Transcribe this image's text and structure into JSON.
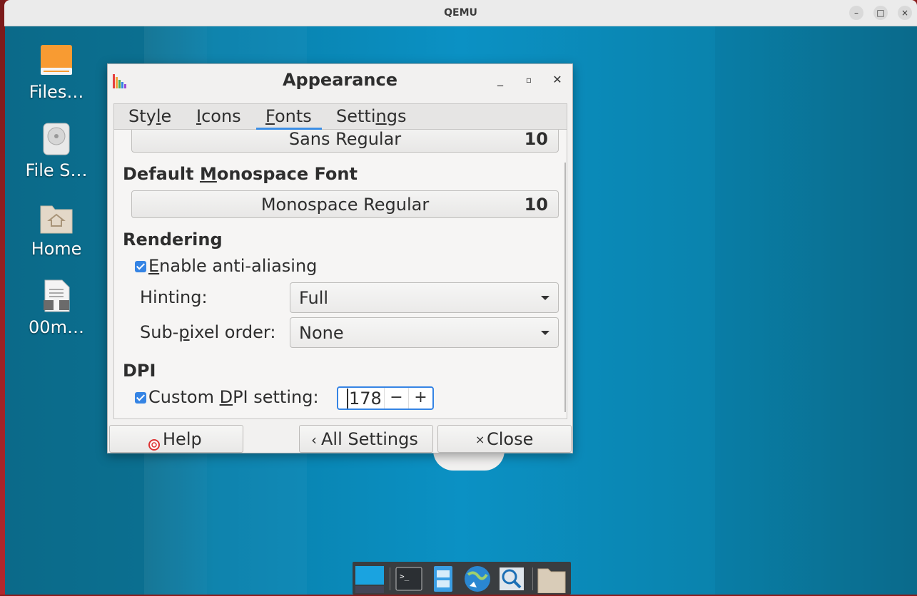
{
  "qemu": {
    "title": "QEMU",
    "buttons": {
      "minimize": "–",
      "maximize": "□",
      "close": "×"
    }
  },
  "desktop": {
    "icons": [
      {
        "label": "Files…",
        "icon": "drive-icon"
      },
      {
        "label": "File S…",
        "icon": "harddisk-icon"
      },
      {
        "label": "Home",
        "icon": "home-folder-icon"
      },
      {
        "label": "00m…",
        "icon": "locked-document-icon"
      }
    ]
  },
  "dialog": {
    "title": "Appearance",
    "tabs": [
      {
        "label": "Style",
        "mnemonic_index": 2
      },
      {
        "label": "Icons",
        "mnemonic_index": 0
      },
      {
        "label": "Fonts",
        "mnemonic_index": 0,
        "active": true
      },
      {
        "label": "Settings",
        "mnemonic_index": 5
      }
    ],
    "fonts": {
      "default_font": {
        "name": "Sans Regular",
        "size": "10"
      },
      "monospace_heading_pre": "Default ",
      "monospace_heading_mn": "M",
      "monospace_heading_post": "onospace Font",
      "monospace_font": {
        "name": "Monospace Regular",
        "size": "10"
      }
    },
    "rendering": {
      "heading": "Rendering",
      "antialias_mn": "E",
      "antialias_rest": "nable anti-aliasing",
      "antialias_checked": true,
      "hinting_label_pre": "Hinting",
      "hinting_label_post": ":",
      "hinting_value": "Full",
      "subpixel_pre": "Sub-",
      "subpixel_mn": "p",
      "subpixel_post": "ixel order:",
      "subpixel_value": "None"
    },
    "dpi": {
      "heading": "DPI",
      "custom_pre": "Custom ",
      "custom_mn": "D",
      "custom_post": "PI setting:",
      "checked": true,
      "value": "178",
      "minus": "−",
      "plus": "+"
    },
    "buttons": {
      "help": "Help",
      "all_settings": "All Settings",
      "close": "Close"
    }
  },
  "colors": {
    "accent": "#3584e4",
    "desktop": "#0b91c4",
    "dock": "#3a3d40"
  }
}
